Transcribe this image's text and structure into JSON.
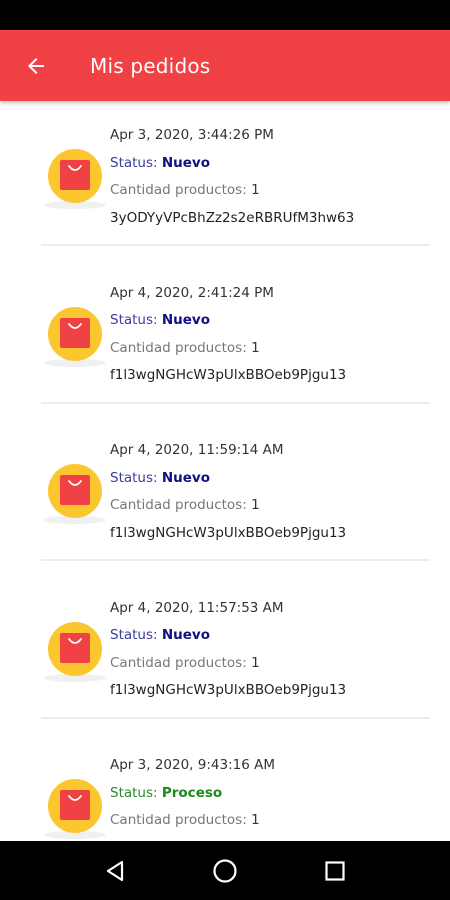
{
  "app_bar": {
    "title": "Mis pedidos",
    "color": "#f04145",
    "back_icon": "arrow-left-icon"
  },
  "orders": [
    {
      "date": "Apr 3, 2020, 3:44:26 PM",
      "status_label": "Status: ",
      "status_value": "Nuevo",
      "status_color": "#101080",
      "quantity_label": "Cantidad productos: ",
      "quantity_value": "1",
      "order_id": "3yODYyVPcBhZz2s2eRBRUfM3hw63"
    },
    {
      "date": "Apr 4, 2020, 2:41:24 PM",
      "status_label": "Status: ",
      "status_value": "Nuevo",
      "status_color": "#101080",
      "quantity_label": "Cantidad productos: ",
      "quantity_value": "1",
      "order_id": "f1l3wgNGHcW3pUlxBBOeb9Pjgu13"
    },
    {
      "date": "Apr 4, 2020, 11:59:14 AM",
      "status_label": "Status: ",
      "status_value": "Nuevo",
      "status_color": "#101080",
      "quantity_label": "Cantidad productos: ",
      "quantity_value": "1",
      "order_id": "f1l3wgNGHcW3pUlxBBOeb9Pjgu13"
    },
    {
      "date": "Apr 4, 2020, 11:57:53 AM",
      "status_label": "Status: ",
      "status_value": "Nuevo",
      "status_color": "#101080",
      "quantity_label": "Cantidad productos: ",
      "quantity_value": "1",
      "order_id": "f1l3wgNGHcW3pUlxBBOeb9Pjgu13"
    },
    {
      "date": "Apr 3, 2020, 9:43:16 AM",
      "status_label": "Status: ",
      "status_value": "Proceso",
      "status_color": "#1a8a1a",
      "quantity_label": "Cantidad productos: ",
      "quantity_value": "1",
      "order_id": ""
    }
  ],
  "icons": {
    "order": "shopping-bag-icon",
    "nav_back": "nav-back-triangle-icon",
    "nav_home": "nav-home-circle-icon",
    "nav_recents": "nav-recents-square-icon"
  }
}
